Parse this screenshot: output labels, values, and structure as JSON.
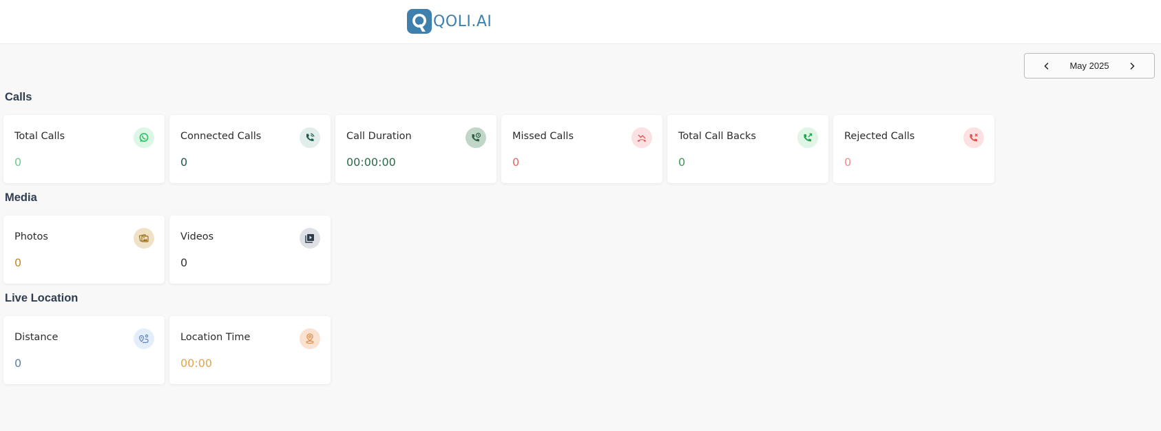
{
  "brand": {
    "name": "QOLI.AI",
    "color": "#3f7fae"
  },
  "date_filter": {
    "label": "May 2025"
  },
  "sections": [
    {
      "title": "Calls",
      "cards": [
        {
          "title": "Total Calls",
          "value": "0",
          "icon": "whatsapp-icon",
          "value_color": "#66cf8a",
          "icon_bg": "#dcf7e5",
          "icon_color": "#25c15f"
        },
        {
          "title": "Connected Calls",
          "value": "0",
          "icon": "phone-connected-icon",
          "value_color": "#1e5c4a",
          "icon_bg": "#e2eeeb",
          "icon_color": "#1e5c4a"
        },
        {
          "title": "Call Duration",
          "value": "00:00:00",
          "icon": "phone-clock-icon",
          "value_color": "#2b6a47",
          "icon_bg": "#bfd6c8",
          "icon_color": "#2b5e45"
        },
        {
          "title": "Missed Calls",
          "value": "0",
          "icon": "phone-missed-icon",
          "value_color": "#e06a6a",
          "icon_bg": "#fbe1e1",
          "icon_color": "#e25454"
        },
        {
          "title": "Total Call Backs",
          "value": "0",
          "icon": "phone-callback-icon",
          "value_color": "#3a9a55",
          "icon_bg": "#dff5e6",
          "icon_color": "#1ea24d"
        },
        {
          "title": "Rejected Calls",
          "value": "0",
          "icon": "phone-rejected-icon",
          "value_color": "#ee8d8d",
          "icon_bg": "#fbe1e1",
          "icon_color": "#e25454"
        }
      ]
    },
    {
      "title": "Media",
      "cards": [
        {
          "title": "Photos",
          "value": "0",
          "icon": "photos-icon",
          "value_color": "#b78b2c",
          "icon_bg": "#efe2c6",
          "icon_color": "#9b6e17"
        },
        {
          "title": "Videos",
          "value": "0",
          "icon": "video-library-icon",
          "value_color": "#333333",
          "icon_bg": "#dde1e6",
          "icon_color": "#2e3b4b"
        }
      ]
    },
    {
      "title": "Live Location",
      "cards": [
        {
          "title": "Distance",
          "value": "0",
          "icon": "route-distance-icon",
          "value_color": "#5b7fb0",
          "icon_bg": "#e4eefa",
          "icon_color": "#5b82b9"
        },
        {
          "title": "Location Time",
          "value": "00:00",
          "icon": "location-pin-icon",
          "value_color": "#e0a54d",
          "icon_bg": "#fbe1cf",
          "icon_color": "#e08d4a"
        }
      ]
    }
  ]
}
